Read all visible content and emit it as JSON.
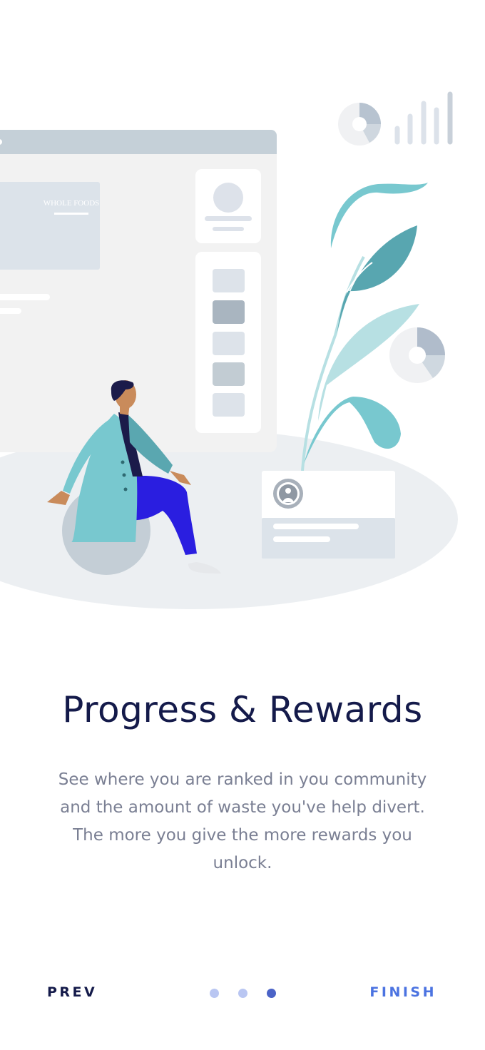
{
  "onboarding": {
    "title": "Progress & Rewards",
    "description": "See where you are ranked in you community and the amount of waste you've help divert. The more you give the more rewards you unlock.",
    "prev_label": "PREV",
    "finish_label": "FINISH",
    "pager": {
      "total": 3,
      "active_index": 2
    }
  },
  "illustration": {
    "brand_card_text": "WHOLE FOODS"
  },
  "colors": {
    "title": "#141a4a",
    "body_text": "#7a7f93",
    "accent": "#4b73e1",
    "dot_inactive": "#b9c6f2",
    "dot_active": "#4b63c7",
    "teal": "#78c8cf",
    "blue_pants": "#2a1ee0"
  }
}
